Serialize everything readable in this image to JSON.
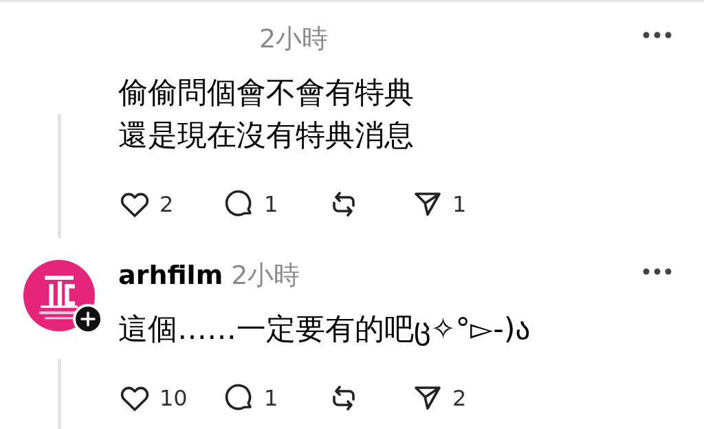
{
  "posts": [
    {
      "time": "2小時",
      "lines": [
        "偷偷問個會不會有特典",
        "還是現在沒有特典消息"
      ],
      "likes": "2",
      "replies": "1",
      "shares": "1"
    },
    {
      "username": "arhfilm",
      "time": "2小時",
      "lines": [
        "這個……一定要有的吧ც✧°▻-)ა"
      ],
      "likes": "10",
      "replies": "1",
      "shares": "2"
    }
  ]
}
